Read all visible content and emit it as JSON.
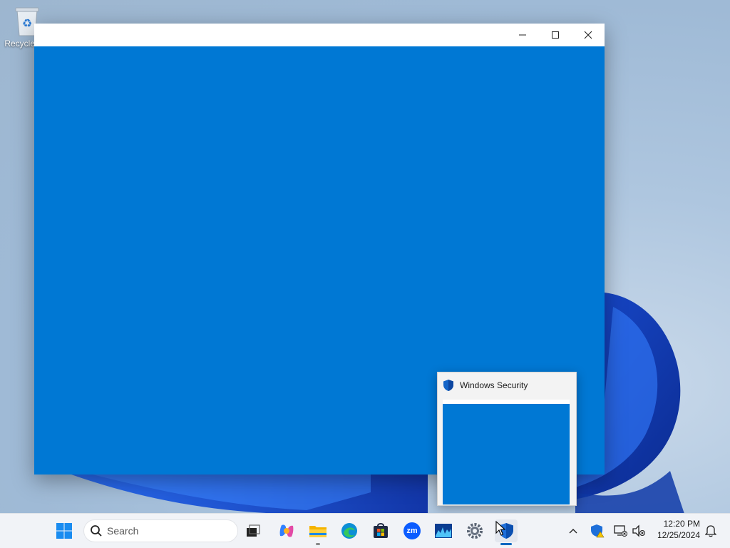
{
  "desktop": {
    "recycle_bin_label": "Recycle Bin"
  },
  "app_window": {
    "title": "",
    "client_color": "#0078d4",
    "buttons": {
      "minimize": "minimize-icon",
      "maximize": "maximize-icon",
      "close": "close-icon"
    }
  },
  "thumbnail": {
    "title": "Windows Security",
    "icon": "shield-icon"
  },
  "taskbar": {
    "search_placeholder": "Search",
    "pinned": [
      {
        "name": "start-button",
        "icon": "windows-logo-icon"
      },
      {
        "name": "task-view-button",
        "icon": "task-view-icon"
      },
      {
        "name": "copilot-button",
        "icon": "copilot-icon"
      },
      {
        "name": "file-explorer-button",
        "icon": "folder-icon"
      },
      {
        "name": "edge-button",
        "icon": "edge-icon"
      },
      {
        "name": "store-button",
        "icon": "store-icon"
      },
      {
        "name": "zoom-button",
        "icon": "zoom-icon",
        "text": "zm"
      },
      {
        "name": "resource-monitor-button",
        "icon": "chart-icon"
      },
      {
        "name": "settings-button",
        "icon": "gear-icon"
      },
      {
        "name": "windows-security-button",
        "icon": "shield-icon"
      }
    ],
    "tray": {
      "overflow_icon": "chevron-up-icon",
      "security_icon": "shield-warning-icon",
      "network_icon": "network-disconnected-icon",
      "volume_icon": "volume-muted-icon",
      "notification_icon": "bell-icon"
    },
    "clock": {
      "time": "12:20 PM",
      "date": "12/25/2024"
    },
    "accent_color": "#0067c0"
  }
}
